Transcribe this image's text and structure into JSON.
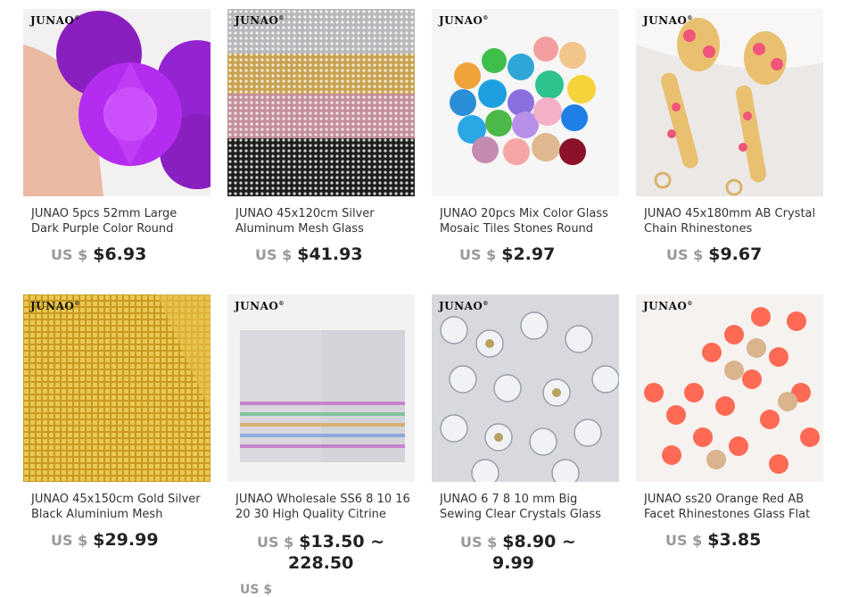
{
  "brand": "JUNAO",
  "currency": "US $",
  "products": [
    {
      "title": "JUNAO 5pcs 52mm Large Dark Purple Color Round",
      "price": "$6.93"
    },
    {
      "title": "JUNAO 45x120cm Silver Aluminum Mesh Glass",
      "price": "$41.93"
    },
    {
      "title": "JUNAO 20pcs Mix Color Glass Mosaic Tiles Stones Round",
      "price": "$2.97"
    },
    {
      "title": "JUNAO 45x180mm AB Crystal Chain Rhinestones",
      "price": "$9.67"
    },
    {
      "title": "JUNAO 45x150cm Gold Silver Black Aluminium Mesh",
      "price": "$29.99"
    },
    {
      "title": "JUNAO Wholesale SS6 8 10 16 20 30 High Quality Citrine",
      "price": "$13.50 ~",
      "price_cont": "228.50"
    },
    {
      "title": "JUNAO 6 7 8 10 mm Big Sewing Clear Crystals Glass",
      "price": "$8.90 ~",
      "price_cont": "9.99"
    },
    {
      "title": "JUNAO ss20 Orange Red AB Facet Rhinestones Glass Flat",
      "price": "$3.85"
    }
  ],
  "next_row_currency": "US $",
  "icons": [
    "product-photo-purple-stones",
    "product-photo-mesh",
    "product-photo-glass-cabochons",
    "product-photo-crystal-chain",
    "product-photo-gold-mesh",
    "product-photo-rhinestone-bags",
    "product-photo-sew-on-crystals",
    "product-photo-orange-rhinestones"
  ]
}
